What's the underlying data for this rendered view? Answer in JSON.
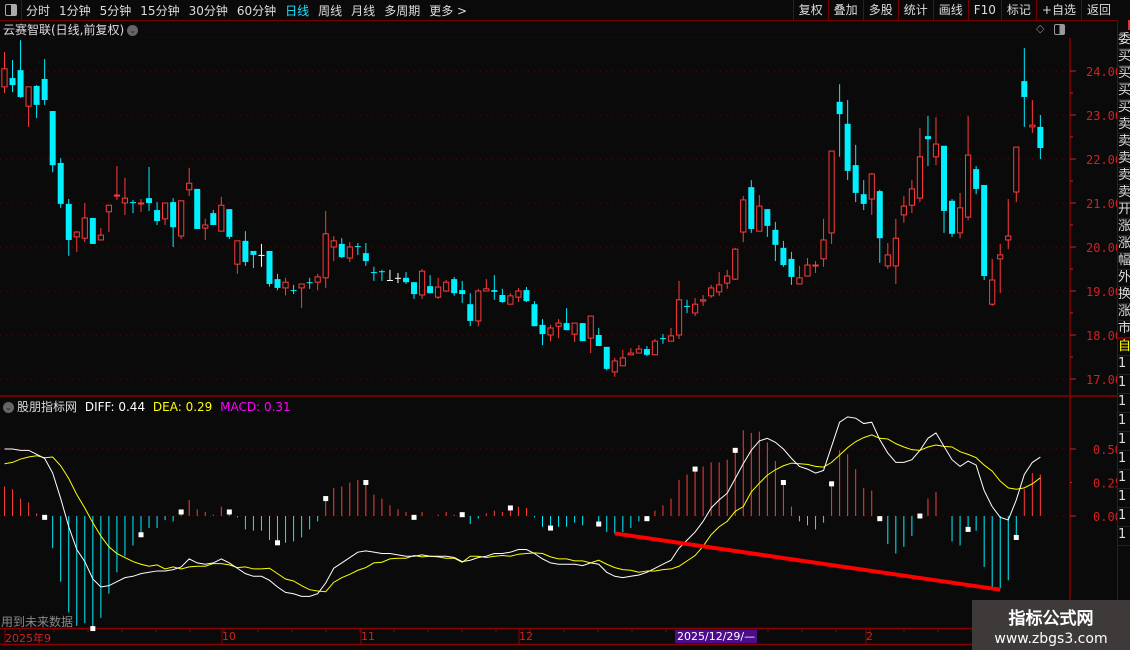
{
  "toolbar": {
    "periods": [
      "分时",
      "1分钟",
      "5分钟",
      "15分钟",
      "30分钟",
      "60分钟",
      "日线",
      "周线",
      "月线",
      "多周期",
      "更多 >"
    ],
    "active_period": "日线",
    "buttons": [
      "复权",
      "叠加",
      "多股",
      "统计",
      "画线",
      "F10",
      "标记",
      "+自选",
      "返回"
    ]
  },
  "stock_title": "云赛智联(日线,前复权)",
  "price_axis": [
    "24.00",
    "23.00",
    "22.00",
    "21.00",
    "20.00",
    "19.00",
    "18.00",
    "17.00"
  ],
  "macd_axis": [
    "0.50",
    "0.25",
    "0.00"
  ],
  "macd_header": {
    "name": "股朋指标网",
    "diff": "DIFF: 0.44",
    "dea": "DEA: 0.29",
    "macd": "MACD: 0.31"
  },
  "future_note": "用到未来数据",
  "x_axis": {
    "labels": [
      "2025年9",
      "10",
      "11",
      "12",
      "2",
      "2025/12/29/—"
    ]
  },
  "right_strip": {
    "top_labels": [
      "委",
      "买",
      "买",
      "买",
      "买",
      "卖",
      "卖",
      "卖",
      "卖",
      "卖",
      "开",
      "涨",
      "涨",
      "幅",
      "外",
      "换",
      "涨",
      "市"
    ],
    "sub_label": "自",
    "rows": [
      "1",
      "1",
      "1",
      "1",
      "1",
      "1",
      "1",
      "1",
      "1",
      "1"
    ]
  },
  "watermark": {
    "name": "指标公式网",
    "url": "www.zbgs3.com"
  },
  "colors": {
    "up": "#ff3a3a",
    "down": "#00f0ff",
    "flat": "#ffffff",
    "diff": "#ffffff",
    "dea": "#ffff00",
    "macd": "#ff00ff",
    "axis": "#d42020",
    "trendline": "#ff0000"
  },
  "chart_data": {
    "type": "candlestick",
    "price_range": [
      17,
      24
    ],
    "candles": [
      [
        23.64,
        24.43,
        23.5,
        24.05
      ],
      [
        23.84,
        24.25,
        23.52,
        23.68
      ],
      [
        24.02,
        24.7,
        23.39,
        23.41
      ],
      [
        23.2,
        23.64,
        22.73,
        23.64
      ],
      [
        23.66,
        23.68,
        22.93,
        23.23
      ],
      [
        23.82,
        24.27,
        23.23,
        23.34
      ],
      [
        23.09,
        23.09,
        21.7,
        21.86
      ],
      [
        21.91,
        22.02,
        20.89,
        20.98
      ],
      [
        20.98,
        21.09,
        19.8,
        20.16
      ],
      [
        20.23,
        20.36,
        19.89,
        20.34
      ],
      [
        20.2,
        21,
        20.11,
        20.66
      ],
      [
        20.66,
        20.66,
        20.07,
        20.07
      ],
      [
        20.16,
        20.43,
        20.16,
        20.27
      ],
      [
        20.8,
        20.95,
        20.34,
        20.95
      ],
      [
        21.16,
        21.84,
        21.07,
        21.18
      ],
      [
        21,
        21.57,
        20.73,
        21.11
      ],
      [
        21.02,
        21.07,
        20.77,
        21
      ],
      [
        20.98,
        21.09,
        20.8,
        21
      ],
      [
        21.11,
        21.82,
        20.82,
        21
      ],
      [
        20.84,
        21.02,
        20.5,
        20.59
      ],
      [
        20.64,
        21,
        20.5,
        21
      ],
      [
        21.02,
        21.11,
        20,
        20.45
      ],
      [
        20.25,
        21.05,
        20.18,
        21.05
      ],
      [
        21.3,
        21.8,
        21.16,
        21.45
      ],
      [
        21.32,
        21.32,
        20.41,
        20.41
      ],
      [
        20.43,
        20.64,
        20.16,
        20.5
      ],
      [
        20.77,
        20.84,
        20.5,
        20.5
      ],
      [
        20.36,
        21.14,
        20.36,
        20.95
      ],
      [
        20.86,
        20.86,
        20.18,
        20.23
      ],
      [
        19.61,
        20.14,
        19.39,
        20.14
      ],
      [
        20.14,
        20.36,
        19.57,
        19.66
      ],
      [
        19.91,
        19.91,
        19.52,
        19.82
      ],
      [
        19.82,
        20.07,
        19.55,
        19.82
      ],
      [
        19.91,
        19.91,
        19.1,
        19.16
      ],
      [
        19.27,
        19.39,
        19.02,
        19.07
      ],
      [
        19.07,
        19.3,
        18.9,
        19.2
      ],
      [
        19.02,
        19.14,
        18.93,
        19
      ],
      [
        19.07,
        19.16,
        18.61,
        19.16
      ],
      [
        19.2,
        19.3,
        19.05,
        19.18
      ],
      [
        19.2,
        19.39,
        19.02,
        19.32
      ],
      [
        19.3,
        20.82,
        19.07,
        20.3
      ],
      [
        20,
        20.25,
        19.68,
        20.14
      ],
      [
        20.07,
        20.2,
        19.75,
        19.77
      ],
      [
        19.75,
        20.11,
        19.66,
        20
      ],
      [
        20.02,
        20.09,
        19.82,
        20
      ],
      [
        19.86,
        20.09,
        19.57,
        19.68
      ],
      [
        19.43,
        19.55,
        19.23,
        19.41
      ],
      [
        19.45,
        19.48,
        19.23,
        19.43
      ],
      [
        19.25,
        19.48,
        19.25,
        19.25
      ],
      [
        19.3,
        19.41,
        19.18,
        19.3
      ],
      [
        19.3,
        19.43,
        19.16,
        19.2
      ],
      [
        19.2,
        19.2,
        18.82,
        18.93
      ],
      [
        18.91,
        19.5,
        18.82,
        19.45
      ],
      [
        19.11,
        19.36,
        18.95,
        18.95
      ],
      [
        18.86,
        19.3,
        18.82,
        19.09
      ],
      [
        19,
        19.25,
        18.98,
        19.2
      ],
      [
        19.27,
        19.32,
        18.89,
        18.95
      ],
      [
        19.02,
        19.23,
        18.73,
        18.93
      ],
      [
        18.7,
        18.95,
        18.2,
        18.32
      ],
      [
        18.32,
        19.05,
        18.2,
        19
      ],
      [
        19,
        19.27,
        19,
        19.05
      ],
      [
        19.02,
        19.36,
        18.8,
        18.98
      ],
      [
        18.91,
        19.05,
        18.73,
        18.75
      ],
      [
        18.7,
        18.95,
        18.7,
        18.89
      ],
      [
        18.86,
        19.07,
        18.75,
        19
      ],
      [
        19.02,
        19.09,
        18.75,
        18.77
      ],
      [
        18.7,
        18.77,
        18.2,
        18.2
      ],
      [
        18.23,
        18.36,
        17.77,
        18.02
      ],
      [
        18,
        18.23,
        17.86,
        18.16
      ],
      [
        18.2,
        18.36,
        17.93,
        18.27
      ],
      [
        18.27,
        18.61,
        18.11,
        18.11
      ],
      [
        18.02,
        18.27,
        17.84,
        18.27
      ],
      [
        18.27,
        18.27,
        17.86,
        17.86
      ],
      [
        17.93,
        18.43,
        17.59,
        18.43
      ],
      [
        18,
        18.16,
        17.75,
        17.75
      ],
      [
        17.73,
        17.73,
        17.2,
        17.23
      ],
      [
        17.16,
        17.48,
        17.05,
        17.41
      ],
      [
        17.3,
        17.66,
        17.3,
        17.48
      ],
      [
        17.55,
        17.7,
        17.55,
        17.59
      ],
      [
        17.59,
        17.77,
        17.59,
        17.68
      ],
      [
        17.68,
        17.75,
        17.52,
        17.55
      ],
      [
        17.55,
        17.91,
        17.55,
        17.86
      ],
      [
        17.93,
        18.02,
        17.8,
        17.91
      ],
      [
        17.86,
        18.16,
        17.86,
        17.98
      ],
      [
        18,
        19.23,
        17.91,
        18.8
      ],
      [
        18.66,
        18.8,
        18.5,
        18.64
      ],
      [
        18.5,
        18.84,
        18.43,
        18.7
      ],
      [
        18.77,
        18.91,
        18.66,
        18.8
      ],
      [
        18.89,
        19.14,
        18.84,
        19.07
      ],
      [
        18.98,
        19.43,
        18.89,
        19.14
      ],
      [
        19.18,
        19.48,
        19.05,
        19.34
      ],
      [
        19.27,
        19.98,
        19.25,
        19.95
      ],
      [
        20.34,
        21.16,
        20.11,
        21.07
      ],
      [
        21.36,
        21.52,
        20.32,
        20.41
      ],
      [
        20.36,
        21.18,
        20.36,
        20.93
      ],
      [
        20.86,
        20.86,
        20.23,
        20.48
      ],
      [
        20.39,
        20.57,
        19.68,
        20.05
      ],
      [
        19.98,
        20.14,
        19.55,
        19.59
      ],
      [
        19.73,
        19.89,
        19.14,
        19.32
      ],
      [
        19.16,
        19.57,
        19.16,
        19.3
      ],
      [
        19.34,
        19.75,
        19.34,
        19.59
      ],
      [
        19.57,
        19.68,
        19.41,
        19.59
      ],
      [
        19.73,
        20.64,
        19.55,
        20.16
      ],
      [
        20.32,
        22.18,
        20.07,
        22.18
      ],
      [
        23.3,
        23.7,
        22.05,
        23.02
      ],
      [
        22.8,
        23.34,
        21.52,
        21.73
      ],
      [
        21.86,
        22.32,
        21.02,
        21.23
      ],
      [
        21.2,
        21.52,
        20.84,
        20.98
      ],
      [
        21.09,
        21.68,
        20.73,
        21.66
      ],
      [
        21.27,
        21.3,
        19.64,
        20.2
      ],
      [
        19.57,
        20.09,
        19.5,
        19.82
      ],
      [
        19.57,
        20.64,
        19.16,
        20.2
      ],
      [
        20.73,
        21.16,
        20.55,
        20.93
      ],
      [
        20.95,
        21.52,
        20.77,
        21.32
      ],
      [
        21.11,
        22.7,
        21.02,
        22.05
      ],
      [
        22.52,
        22.98,
        21.84,
        22.45
      ],
      [
        22.05,
        22.95,
        21.86,
        22.34
      ],
      [
        22.3,
        22.3,
        20.32,
        20.82
      ],
      [
        21.05,
        21.09,
        20.23,
        20.3
      ],
      [
        20.32,
        21.23,
        20.2,
        20.89
      ],
      [
        20.68,
        22.98,
        20.61,
        22.09
      ],
      [
        21.77,
        21.84,
        21.2,
        21.32
      ],
      [
        21.41,
        21.41,
        19.25,
        19.34
      ],
      [
        18.7,
        19.73,
        18.66,
        19.25
      ],
      [
        19.73,
        20.07,
        18.95,
        19.82
      ],
      [
        20.16,
        21.09,
        19.95,
        20.25
      ],
      [
        21.25,
        22.27,
        21.02,
        22.27
      ],
      [
        23.77,
        24.52,
        22.73,
        23.41
      ],
      [
        22.73,
        23.34,
        22.59,
        22.77
      ],
      [
        22.73,
        23,
        22,
        22.25
      ]
    ],
    "macd": {
      "range": [
        -0.85,
        0.85
      ],
      "diff": [
        0.5,
        0.5,
        0.49,
        0.49,
        0.46,
        0.43,
        0.32,
        0.13,
        -0.08,
        -0.25,
        -0.34,
        -0.47,
        -0.53,
        -0.52,
        -0.49,
        -0.46,
        -0.45,
        -0.43,
        -0.42,
        -0.41,
        -0.41,
        -0.4,
        -0.38,
        -0.32,
        -0.35,
        -0.36,
        -0.35,
        -0.32,
        -0.35,
        -0.39,
        -0.43,
        -0.45,
        -0.45,
        -0.48,
        -0.53,
        -0.57,
        -0.58,
        -0.6,
        -0.6,
        -0.58,
        -0.5,
        -0.39,
        -0.35,
        -0.31,
        -0.27,
        -0.26,
        -0.27,
        -0.28,
        -0.28,
        -0.29,
        -0.3,
        -0.3,
        -0.29,
        -0.3,
        -0.3,
        -0.3,
        -0.31,
        -0.34,
        -0.33,
        -0.31,
        -0.3,
        -0.28,
        -0.28,
        -0.27,
        -0.25,
        -0.25,
        -0.28,
        -0.32,
        -0.35,
        -0.36,
        -0.36,
        -0.36,
        -0.37,
        -0.35,
        -0.36,
        -0.42,
        -0.45,
        -0.46,
        -0.45,
        -0.44,
        -0.42,
        -0.39,
        -0.36,
        -0.33,
        -0.24,
        -0.18,
        -0.12,
        -0.04,
        0.06,
        0.12,
        0.17,
        0.28,
        0.39,
        0.49,
        0.56,
        0.58,
        0.55,
        0.5,
        0.43,
        0.37,
        0.35,
        0.32,
        0.34,
        0.52,
        0.7,
        0.74,
        0.73,
        0.69,
        0.7,
        0.57,
        0.47,
        0.4,
        0.4,
        0.42,
        0.49,
        0.58,
        0.62,
        0.52,
        0.42,
        0.37,
        0.41,
        0.38,
        0.19,
        0.07,
        -0.01,
        -0.03,
        0.12,
        0.31,
        0.4,
        0.44
      ],
      "hist": [
        0.22,
        0.2,
        0.13,
        0.1,
        0.02,
        -0.01,
        -0.24,
        -0.49,
        -0.72,
        -0.82,
        -0.8,
        -0.84,
        -0.76,
        -0.58,
        -0.42,
        -0.3,
        -0.22,
        -0.14,
        -0.09,
        -0.09,
        -0.03,
        -0.04,
        0.03,
        0.12,
        0.05,
        0.03,
        0.01,
        0.07,
        0.03,
        -0.01,
        -0.1,
        -0.11,
        -0.11,
        -0.18,
        -0.2,
        -0.2,
        -0.19,
        -0.16,
        -0.1,
        -0.04,
        0.13,
        0.21,
        0.22,
        0.25,
        0.27,
        0.25,
        0.16,
        0.13,
        0.08,
        0.05,
        0.03,
        -0.01,
        0.03,
        0.0,
        0.01,
        0.03,
        0.01,
        0.01,
        -0.06,
        -0.02,
        0.02,
        0.04,
        0.03,
        0.06,
        0.07,
        0.06,
        -0.01,
        -0.08,
        -0.09,
        -0.08,
        -0.08,
        -0.05,
        -0.07,
        0.0,
        -0.06,
        -0.12,
        -0.13,
        -0.12,
        -0.09,
        -0.04,
        -0.02,
        0.04,
        0.08,
        0.13,
        0.27,
        0.31,
        0.35,
        0.37,
        0.4,
        0.4,
        0.42,
        0.49,
        0.64,
        0.62,
        0.63,
        0.55,
        0.41,
        0.25,
        0.07,
        -0.04,
        -0.07,
        -0.1,
        -0.05,
        0.24,
        0.49,
        0.46,
        0.35,
        0.21,
        0.19,
        -0.02,
        -0.21,
        -0.28,
        -0.23,
        -0.15,
        0.0,
        0.13,
        0.18,
        0.0,
        -0.19,
        -0.22,
        -0.1,
        -0.11,
        -0.38,
        -0.53,
        -0.54,
        -0.48,
        -0.16,
        0.2,
        0.32,
        0.31
      ],
      "signal_marks": [
        5,
        11,
        17,
        22,
        28,
        34,
        40,
        45,
        51,
        57,
        63,
        68,
        74,
        80,
        86,
        91,
        97,
        103,
        109,
        114,
        120,
        126
      ],
      "trendline": {
        "from": [
          76,
          -0.13
        ],
        "to": [
          124,
          -0.55
        ]
      }
    }
  }
}
